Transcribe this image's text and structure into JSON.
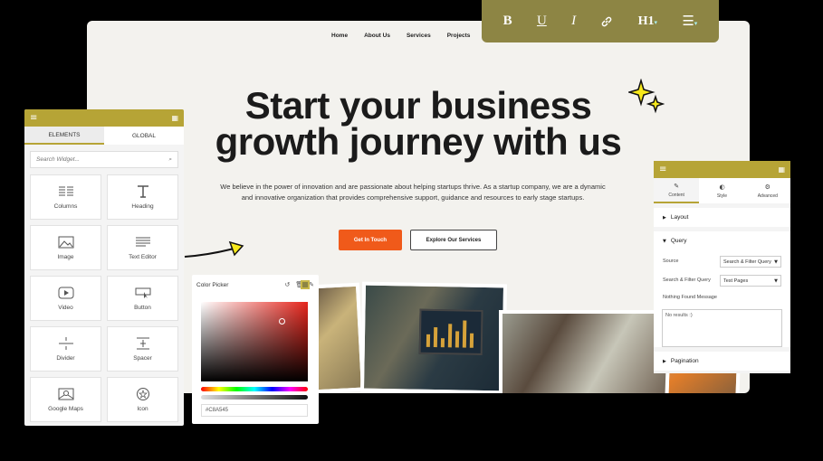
{
  "site": {
    "nav": [
      "Home",
      "About Us",
      "Services",
      "Projects"
    ],
    "title_line1": "Start your business",
    "title_line2": "growth journey with us",
    "subtitle_line1": "We believe in the power of innovation and are passionate about helping startups thrive. As a startup company, we are a dynamic",
    "subtitle_line2": "and innovative organization that provides comprehensive support, guidance and resources to early stage startups.",
    "cta_primary": "Get In Touch",
    "cta_secondary": "Explore Our Services"
  },
  "toolbar": {
    "bold": "B",
    "underline": "U",
    "italic": "I",
    "link": "link-icon",
    "heading": "H1",
    "list": "list-icon"
  },
  "elements_panel": {
    "tabs": [
      "ELEMENTS",
      "GLOBAL"
    ],
    "search_placeholder": "Search Widget...",
    "widgets": [
      {
        "label": "Columns",
        "icon": "columns-icon"
      },
      {
        "label": "Heading",
        "icon": "heading-icon"
      },
      {
        "label": "Image",
        "icon": "image-icon"
      },
      {
        "label": "Text Editor",
        "icon": "text-editor-icon"
      },
      {
        "label": "Video",
        "icon": "video-icon"
      },
      {
        "label": "Button",
        "icon": "button-icon"
      },
      {
        "label": "Divider",
        "icon": "divider-icon"
      },
      {
        "label": "Spacer",
        "icon": "spacer-icon"
      },
      {
        "label": "Google Maps",
        "icon": "map-icon"
      },
      {
        "label": "Icon",
        "icon": "star-icon"
      }
    ]
  },
  "color_picker": {
    "title": "Color Picker",
    "value": "#C8A545"
  },
  "settings_panel": {
    "tabs": [
      "Content",
      "Style",
      "Advanced"
    ],
    "layout_label": "Layout",
    "query_label": "Query",
    "source_label": "Source",
    "source_value": "Search & Filter Query",
    "sfq_label": "Search & Filter Query",
    "sfq_value": "Test Pages",
    "nothing_found_label": "Nothing Found Message",
    "nothing_found_value": "No results :)",
    "pagination_label": "Pagination"
  },
  "colors": {
    "accent": "#B6A436",
    "toolbar": "#8D8544",
    "cta": "#F05A1A"
  }
}
